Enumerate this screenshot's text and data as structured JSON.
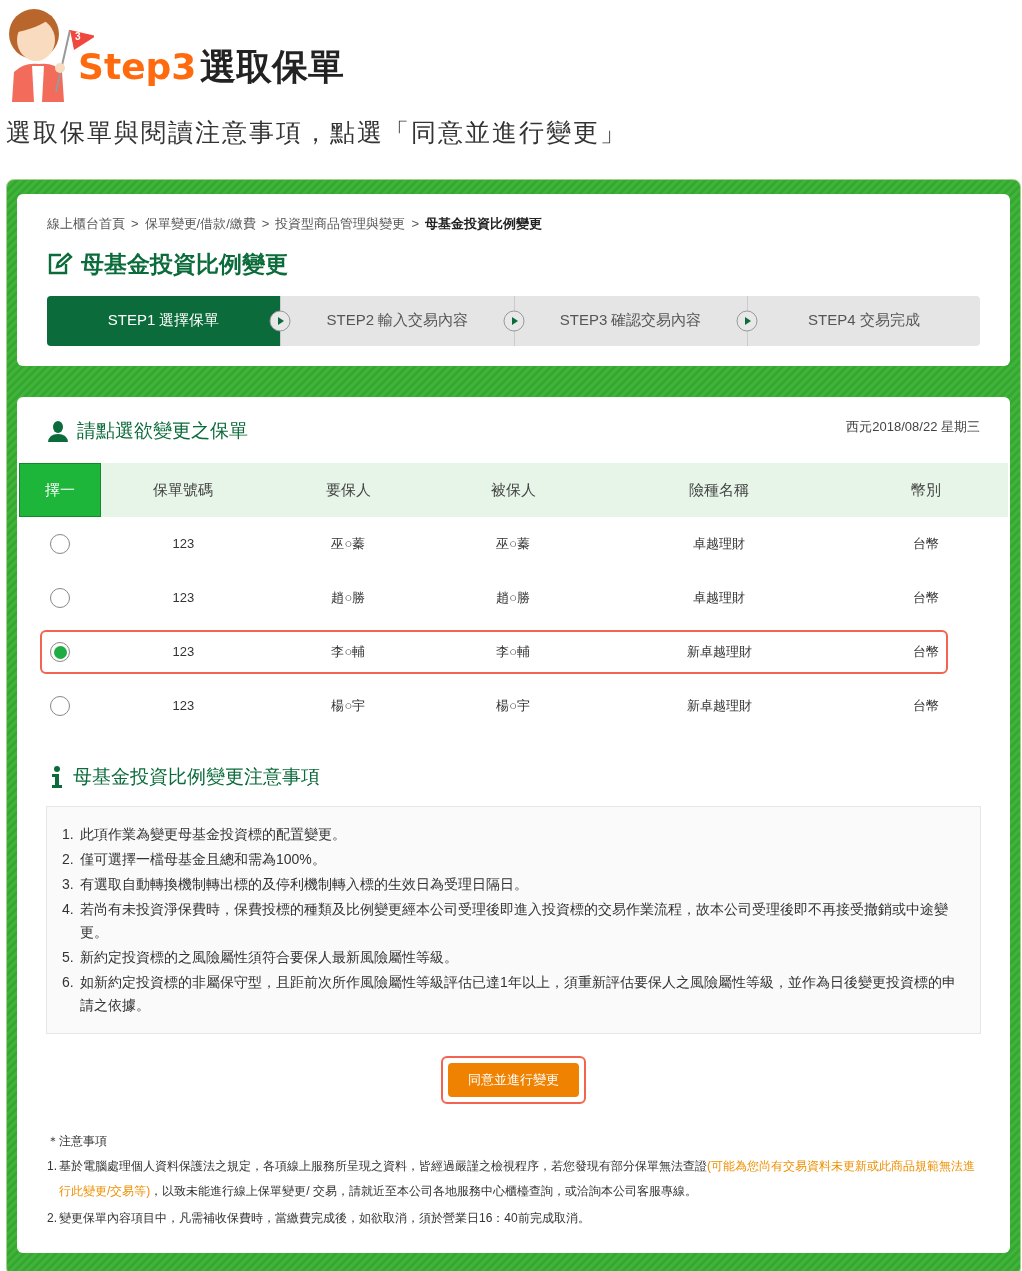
{
  "header": {
    "flag_number": "3",
    "step": "Step3",
    "title": "選取保單",
    "instruction": "選取保單與閱讀注意事項，點選「同意並進行變更」"
  },
  "breadcrumb": [
    {
      "label": "線上櫃台首頁",
      "current": false
    },
    {
      "label": "保單變更/借款/繳費",
      "current": false
    },
    {
      "label": "投資型商品管理與變更",
      "current": false
    },
    {
      "label": "母基金投資比例變更",
      "current": true
    }
  ],
  "breadcrumb_separator": ">",
  "page_title": "母基金投資比例變更",
  "steps": [
    {
      "label": "STEP1 選擇保單",
      "selected": true
    },
    {
      "label": "STEP2 輸入交易內容",
      "selected": false
    },
    {
      "label": "STEP3 確認交易內容",
      "selected": false
    },
    {
      "label": "STEP4 交易完成",
      "selected": false
    }
  ],
  "policy_section": {
    "title": "請點選欲變更之保單",
    "date": "西元2018/08/22 星期三"
  },
  "table": {
    "select_column": "擇一",
    "columns": [
      "保單號碼",
      "要保人",
      "被保人",
      "險種名稱",
      "幣別"
    ],
    "rows": [
      {
        "selected": false,
        "highlighted": false,
        "cells": [
          "123",
          "巫○蓁",
          "巫○蓁",
          "卓越理財",
          "台幣"
        ]
      },
      {
        "selected": false,
        "highlighted": false,
        "cells": [
          "123",
          "趙○勝",
          "趙○勝",
          "卓越理財",
          "台幣"
        ]
      },
      {
        "selected": true,
        "highlighted": true,
        "cells": [
          "123",
          "李○輔",
          "李○輔",
          "新卓越理財",
          "台幣"
        ]
      },
      {
        "selected": false,
        "highlighted": false,
        "cells": [
          "123",
          "楊○宇",
          "楊○宇",
          "新卓越理財",
          "台幣"
        ]
      }
    ]
  },
  "notice": {
    "title": "母基金投資比例變更注意事項",
    "items": [
      {
        "number": "1.",
        "text": "此項作業為變更母基金投資標的配置變更。"
      },
      {
        "number": "2.",
        "text": "僅可選擇一檔母基金且總和需為100%。"
      },
      {
        "number": "3.",
        "text": "有選取自動轉換機制轉出標的及停利機制轉入標的生效日為受理日隔日。"
      },
      {
        "number": "4.",
        "text": "若尚有未投資淨保費時，保費投標的種類及比例變更經本公司受理後即進入投資標的交易作業流程，故本公司受理後即不再接受撤銷或中途變更。"
      },
      {
        "number": "5.",
        "text": "新約定投資標的之風險屬性須符合要保人最新風險屬性等級。"
      },
      {
        "number": "6.",
        "text": "如新約定投資標的非屬保守型，且距前次所作風險屬性等級評估已達1年以上，須重新評估要保人之風險屬性等級，並作為日後變更投資標的申請之依據。"
      }
    ]
  },
  "agree_button": {
    "label": "同意並進行變更",
    "highlighted": true
  },
  "footnote": {
    "title": "＊注意事項",
    "items": [
      {
        "number": "1.",
        "segments": [
          {
            "text": "基於電腦處理個人資料保護法之規定，各項線上服務所呈現之資料，皆經過嚴謹之檢視程序，若您發現有部分保單無法查證",
            "highlight": false
          },
          {
            "text": "(可能為您尚有交易資料未更新或此商品規範無法進行此變更/交易等)",
            "highlight": true
          },
          {
            "text": "，以致未能進行線上保單變更/ 交易，請就近至本公司各地服務中心櫃檯查詢，或洽詢本公司客服專線。",
            "highlight": false
          }
        ]
      },
      {
        "number": "2.",
        "segments": [
          {
            "text": "變更保單內容項目中，凡需補收保費時，當繳費完成後，如欲取消，須於營業日16：40前完成取消。",
            "highlight": false
          }
        ]
      }
    ]
  }
}
